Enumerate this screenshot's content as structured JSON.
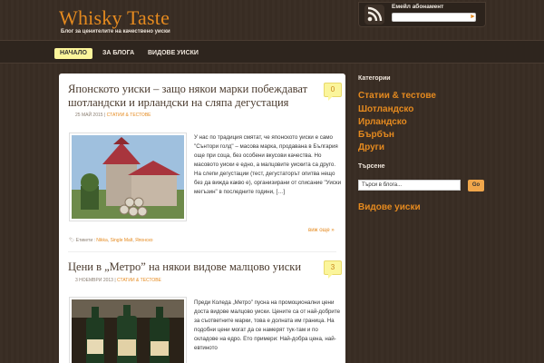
{
  "header": {
    "site_title": "Whisky Taste",
    "site_description": "Блог за ценителите на качествено уиски"
  },
  "subscribe": {
    "label": "Емейл абонамент",
    "icon": "rss-icon",
    "button_icon": "arrow-right-icon"
  },
  "nav": {
    "items": [
      {
        "label": "НАЧАЛО",
        "active": true
      },
      {
        "label": "ЗА БЛОГА",
        "active": false
      },
      {
        "label": "ВИДОВЕ УИСКИ",
        "active": false
      }
    ]
  },
  "posts": [
    {
      "title": "Японското уиски – защо някои марки побеждават шотландски и ирландски на сляпа дегустация",
      "date": "25 МАЙ 2015",
      "category": "СТАТИИ & ТЕСТОВЕ",
      "comments": "0",
      "excerpt": "У нас по традиция смятат, че японското уиски е само \"Сънтори голд\" – масова марка, продавана в България още при соца, без особени вкусови качества. Но масовото уиски е едно, а малцовите уискита са друго. На слепи дегустации (тест, дегустаторът опитва нещо без да вижда какво е), организирани от списание \"Уиски мегъзин\" в последните години, […]",
      "more": "виж още »",
      "tags_label": "Етикети :",
      "tags": [
        "Nikka",
        "Single Malt",
        "Японско"
      ]
    },
    {
      "title": "Цени в „Метро” на някои видове малцово уиски",
      "date": "3 НОЕМВРИ 2013",
      "category": "СТАТИИ & ТЕСТОВЕ",
      "comments": "3",
      "excerpt": "Преди Коледа „Метро” пусна на промоционални цени доста видове малцово уиски. Цените са от най-добрите за съответните марки, това е долната им граница. На подобни цени могат да се намерят тук-там и по складове на едро. Ето примери: Най-добра цена, най-евтиното"
    }
  ],
  "sidebar": {
    "categories_title": "Категории",
    "categories": [
      "Статии & тестове",
      "Шотландско",
      "Ирландско",
      "Бърбън",
      "Други"
    ],
    "search_title": "Търсене",
    "search_value": "Търси в блога...",
    "search_button": "Go",
    "whisky_types": "Видове уиски"
  },
  "colors": {
    "accent": "#e58a1f",
    "background": "#3a2e25",
    "nav_active": "#fbf59b"
  }
}
